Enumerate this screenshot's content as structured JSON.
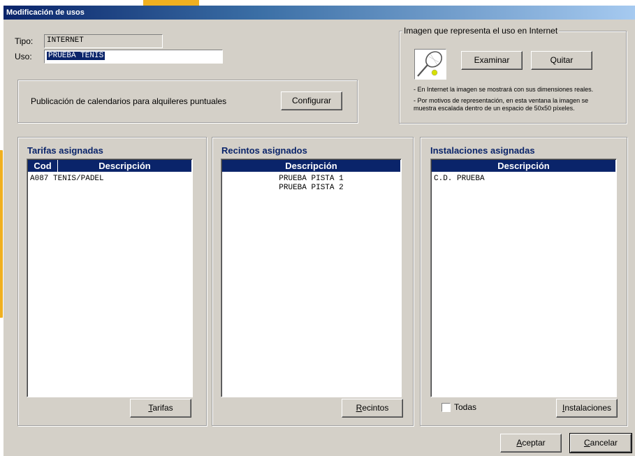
{
  "window": {
    "title": "Modificación de usos"
  },
  "tipo": {
    "label": "Tipo:",
    "value": "INTERNET"
  },
  "uso": {
    "label": "Uso:",
    "value": "PRUEBA TENIS"
  },
  "calendar": {
    "text": "Publicación de calendarios para alquileres puntuales",
    "button": "Configurar"
  },
  "image_group": {
    "legend": "Imagen que representa el uso en Internet",
    "icon": "tennis-racket-icon",
    "examinar": "Examinar",
    "quitar": "Quitar",
    "note1": "- En Internet la imagen se mostrará con sus dimensiones reales.",
    "note2a": "- Por motivos de representación, en esta ventana la imagen se",
    "note2b": "muestra escalada dentro de un espacio de 50x50 píxeles."
  },
  "tarifas": {
    "title": "Tarifas asignadas",
    "col_cod": "Cod",
    "col_desc": "Descripción",
    "rows": [
      {
        "cod": "A087",
        "desc": "TENIS/PADEL"
      }
    ],
    "button_hot": "T",
    "button_rest": "arifas"
  },
  "recintos": {
    "title": "Recintos asignados",
    "col_desc": "Descripción",
    "rows": [
      "PRUEBA PISTA 1",
      "PRUEBA PISTA 2"
    ],
    "button_hot": "R",
    "button_rest": "ecintos"
  },
  "instalaciones": {
    "title": "Instalaciones asignadas",
    "col_desc": "Descripción",
    "rows": [
      "C.D. PRUEBA"
    ],
    "todas": "Todas",
    "button_hot": "I",
    "button_rest": "nstalaciones"
  },
  "footer": {
    "aceptar_hot": "A",
    "aceptar_rest": "ceptar",
    "cancelar_hot": "C",
    "cancelar_rest": "ancelar"
  },
  "colors": {
    "titlebar": "#0a246a",
    "face": "#d4d0c8",
    "accent": "#f0b020"
  }
}
